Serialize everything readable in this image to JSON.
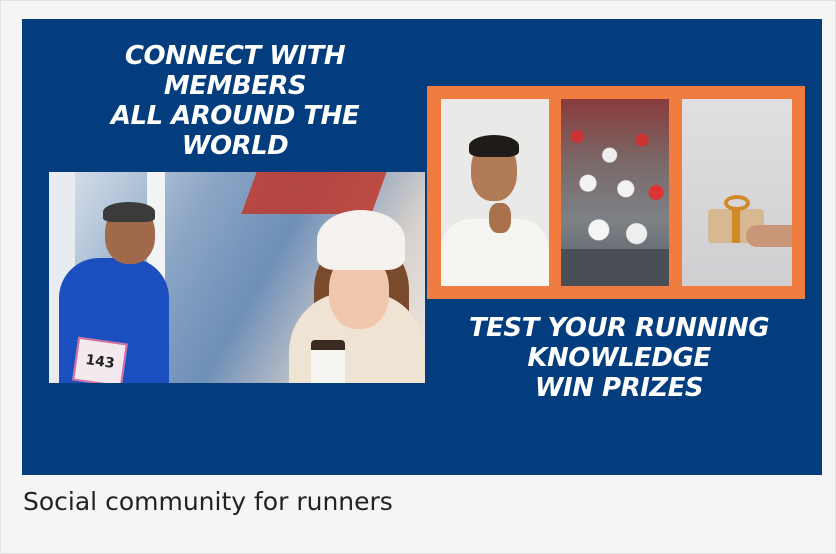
{
  "banner": {
    "headline_left": [
      "CONNECT WITH",
      "MEMBERS",
      "ALL AROUND THE",
      "WORLD"
    ],
    "headline_right": [
      "TEST YOUR RUNNING",
      "KNOWLEDGE",
      "WIN PRIZES"
    ],
    "runner_bib_number": "143",
    "colors": {
      "background": "#033d7d",
      "frame": "#f07c40",
      "text": "#ffffff"
    }
  },
  "caption": "Social community for runners"
}
